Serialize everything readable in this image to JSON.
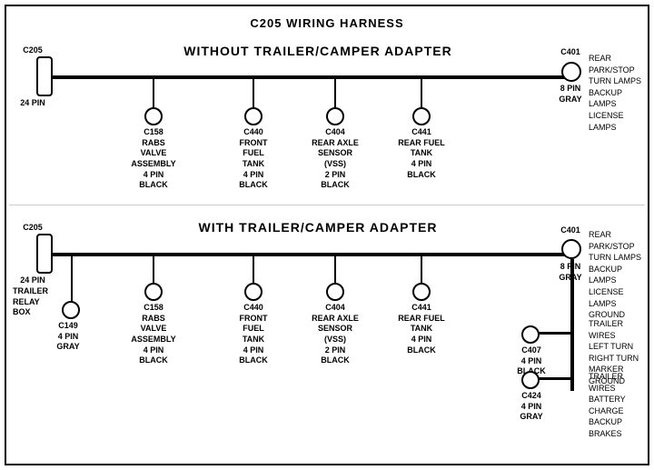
{
  "title": "C205 WIRING HARNESS",
  "section1": {
    "label": "WITHOUT  TRAILER/CAMPER ADAPTER",
    "connectors": [
      {
        "id": "C205_top",
        "label": "C205",
        "sublabel": "24 PIN",
        "type": "rect"
      },
      {
        "id": "C401_top",
        "label": "C401",
        "sublabel": "8 PIN\nGRAY",
        "type": "circle"
      },
      {
        "id": "C158_top",
        "label": "C158",
        "sublabel": "RABS VALVE\nASSEMBLY\n4 PIN BLACK",
        "type": "circle"
      },
      {
        "id": "C440_top",
        "label": "C440",
        "sublabel": "FRONT FUEL\nTANK\n4 PIN BLACK",
        "type": "circle"
      },
      {
        "id": "C404_top",
        "label": "C404",
        "sublabel": "REAR AXLE\nSENSOR\n(VSS)\n2 PIN BLACK",
        "type": "circle"
      },
      {
        "id": "C441_top",
        "label": "C441",
        "sublabel": "REAR FUEL\nTANK\n4 PIN BLACK",
        "type": "circle"
      }
    ],
    "right_label": "REAR PARK/STOP\nTURN LAMPS\nBACKUP LAMPS\nLICENSE LAMPS"
  },
  "section2": {
    "label": "WITH TRAILER/CAMPER ADAPTER",
    "connectors": [
      {
        "id": "C205_bot",
        "label": "C205",
        "sublabel": "24 PIN",
        "type": "rect"
      },
      {
        "id": "C401_bot",
        "label": "C401",
        "sublabel": "8 PIN\nGRAY",
        "type": "circle"
      },
      {
        "id": "C158_bot",
        "label": "C158",
        "sublabel": "RABS VALVE\nASSEMBLY\n4 PIN BLACK",
        "type": "circle"
      },
      {
        "id": "C440_bot",
        "label": "C440",
        "sublabel": "FRONT FUEL\nTANK\n4 PIN BLACK",
        "type": "circle"
      },
      {
        "id": "C404_bot",
        "label": "C404",
        "sublabel": "REAR AXLE\nSENSOR\n(VSS)\n2 PIN BLACK",
        "type": "circle"
      },
      {
        "id": "C441_bot",
        "label": "C441",
        "sublabel": "REAR FUEL\nTANK\n4 PIN BLACK",
        "type": "circle"
      },
      {
        "id": "C149",
        "label": "C149",
        "sublabel": "4 PIN GRAY",
        "type": "circle"
      },
      {
        "id": "C407",
        "label": "C407",
        "sublabel": "4 PIN\nBLACK",
        "type": "circle"
      },
      {
        "id": "C424",
        "label": "C424",
        "sublabel": "4 PIN\nGRAY",
        "type": "circle"
      }
    ],
    "trailer_relay": "TRAILER\nRELAY\nBOX",
    "right_labels": [
      "REAR PARK/STOP\nTURN LAMPS\nBACKUP LAMPS\nLICENSE LAMPS\nGROUND",
      "TRAILER WIRES\nLEFT TURN\nRIGHT TURN\nMARKER\nGROUND",
      "TRAILER WIRES\nBATTERY CHARGE\nBACKUP\nBRAKES"
    ]
  }
}
